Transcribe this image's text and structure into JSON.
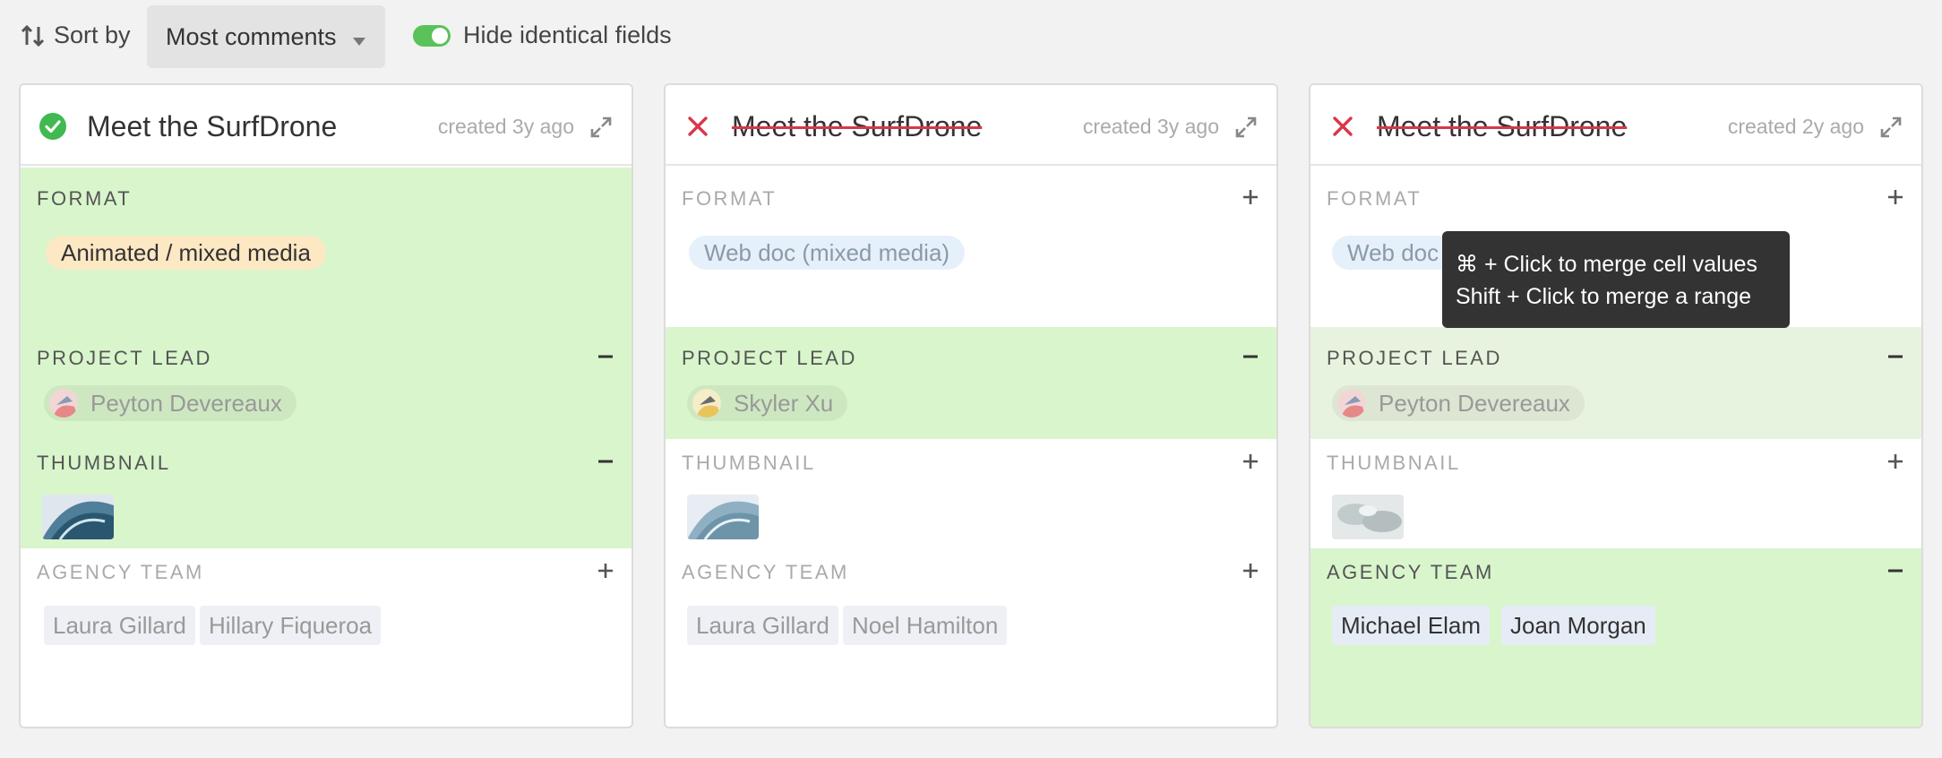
{
  "toolbar": {
    "sort_label": "Sort by",
    "sort_value": "Most comments",
    "hide_toggle_label": "Hide identical fields",
    "hide_toggle_on": true
  },
  "labels": {
    "format": "FORMAT",
    "project_lead": "PROJECT LEAD",
    "thumbnail": "THUMBNAIL",
    "agency_team": "AGENCY TEAM"
  },
  "cards": [
    {
      "status": "selected",
      "title": "Meet the SurfDrone",
      "created": "created 3y ago",
      "format": "Animated / mixed media",
      "project_lead": "Peyton Devereaux",
      "agency_team": [
        "Laura Gillard",
        "Hillary Fiqueroa"
      ]
    },
    {
      "status": "rejected",
      "title": "Meet the SurfDrone",
      "created": "created 3y ago",
      "format": "Web doc (mixed media)",
      "project_lead": "Skyler Xu",
      "agency_team": [
        "Laura Gillard",
        "Noel Hamilton"
      ]
    },
    {
      "status": "rejected",
      "title": "Meet the SurfDrone",
      "created": "created 2y ago",
      "format": "Web doc",
      "project_lead": "Peyton Devereaux",
      "agency_team": [
        "Michael Elam",
        "Joan Morgan"
      ]
    }
  ],
  "tooltip": {
    "line1": "⌘ + Click to merge cell values",
    "line2": "Shift + Click to merge a range"
  },
  "colors": {
    "selected_bg": "#d9f5cc",
    "accent_green": "#5ac25a",
    "reject_red": "#d9364a"
  }
}
